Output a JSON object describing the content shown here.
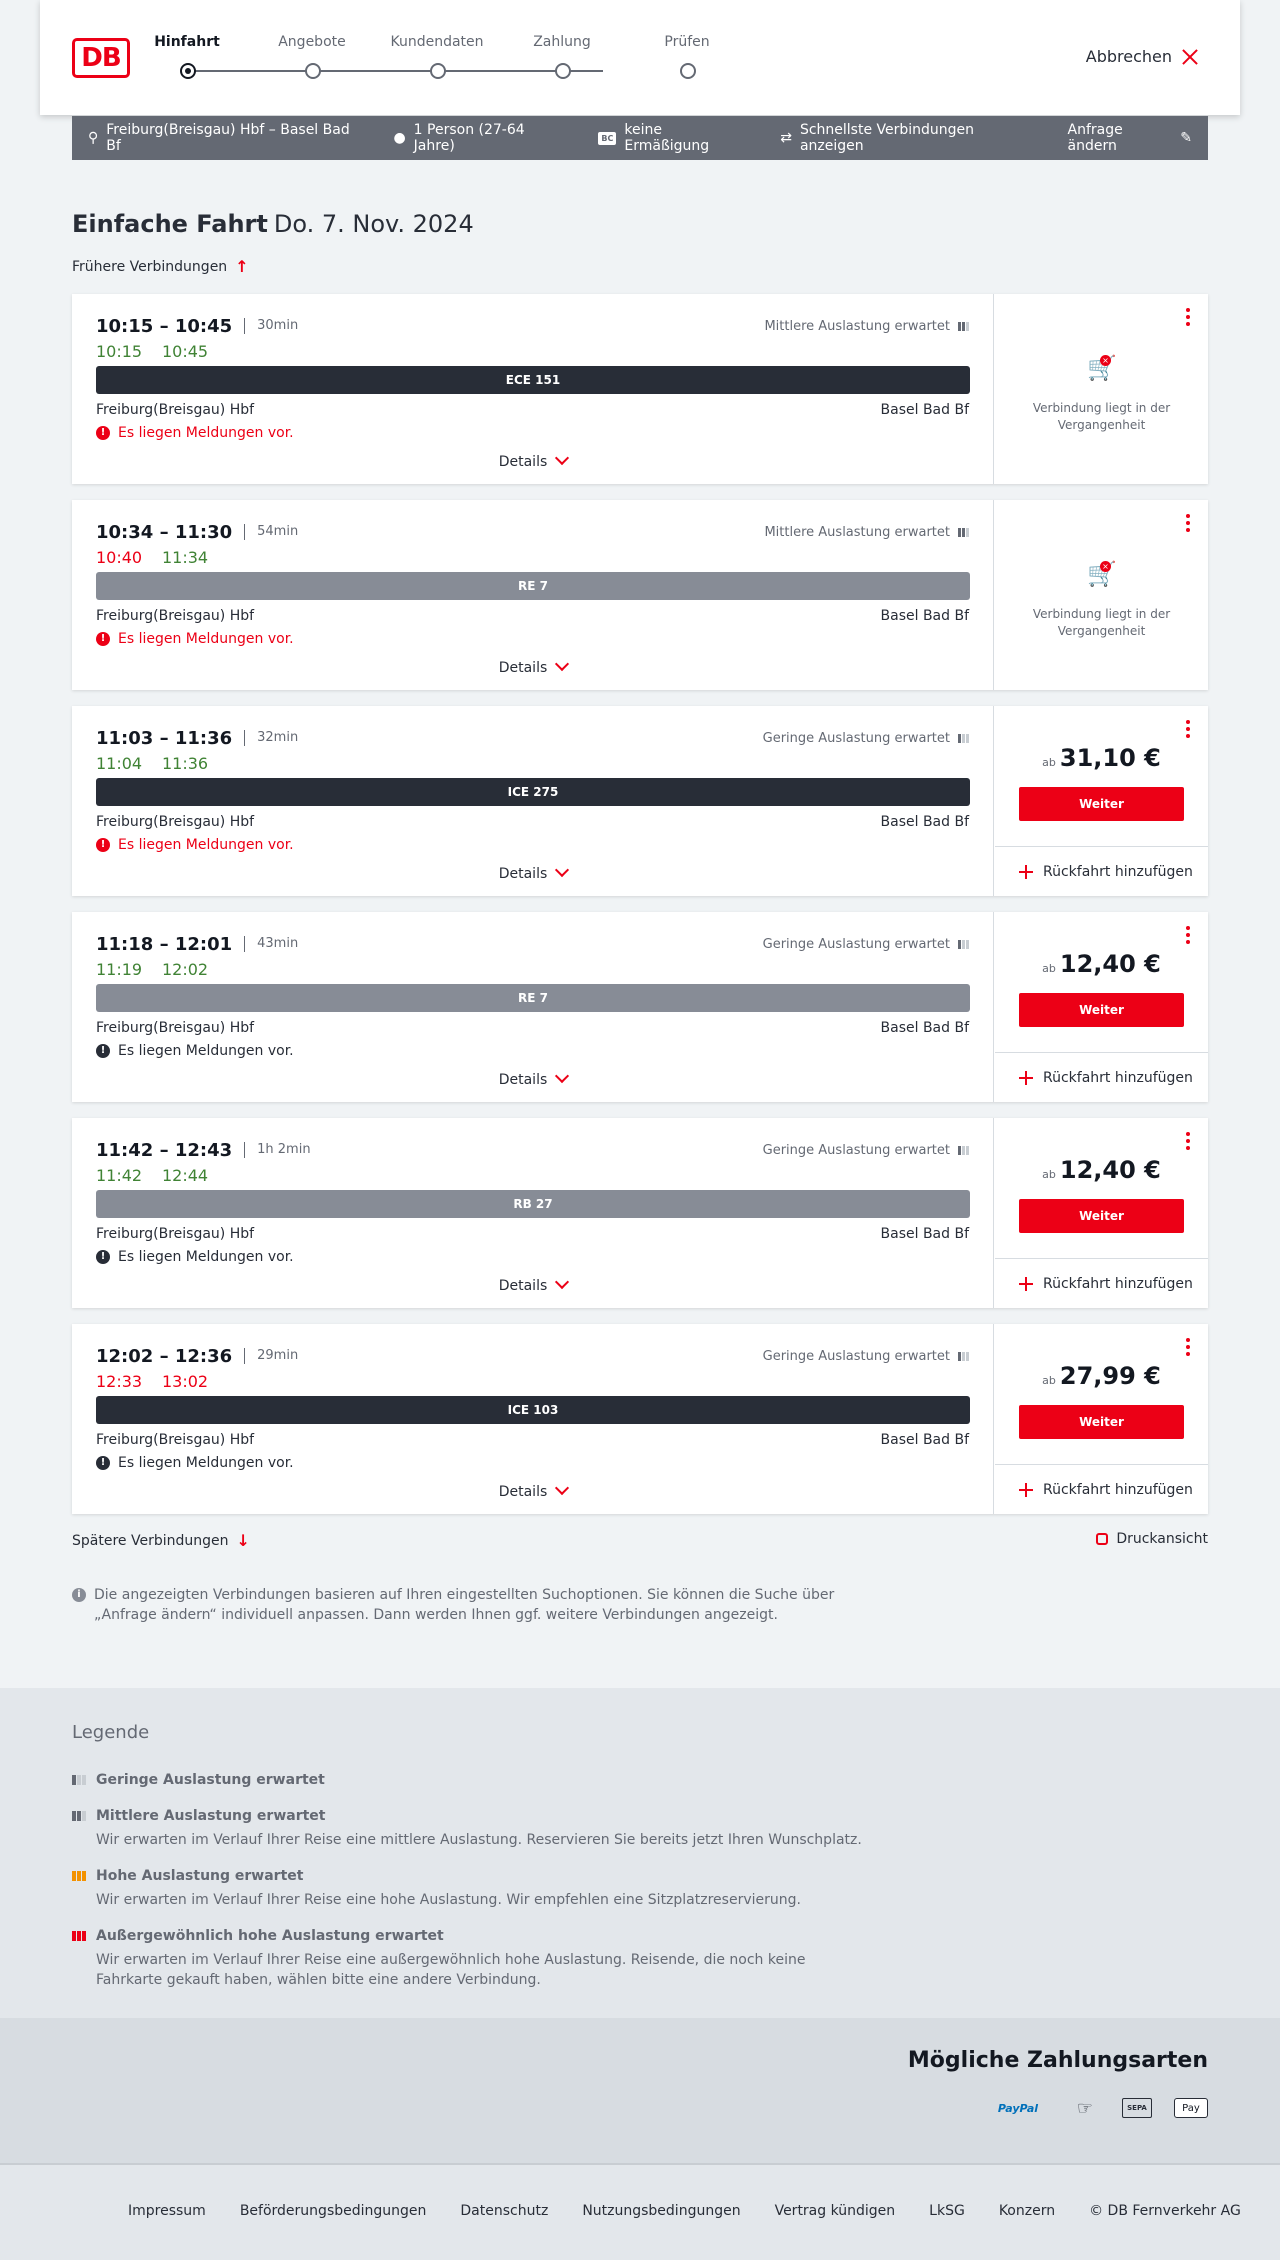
{
  "header": {
    "logo": "DB",
    "steps": [
      {
        "label": "Hinfahrt",
        "active": true
      },
      {
        "label": "Angebote",
        "active": false
      },
      {
        "label": "Kundendaten",
        "active": false
      },
      {
        "label": "Zahlung",
        "active": false
      },
      {
        "label": "Prüfen",
        "active": false
      }
    ],
    "cancel_label": "Abbrechen"
  },
  "search": {
    "route": "Freiburg(Breisgau) Hbf – Basel Bad Bf",
    "passengers": "1 Person (27-64 Jahre)",
    "bc_badge": "BC",
    "discount": "keine Ermäßigung",
    "fastest": "Schnellste Verbindungen anzeigen",
    "edit_label": "Anfrage ändern"
  },
  "title": {
    "main": "Einfache Fahrt",
    "date": "Do. 7. Nov. 2024"
  },
  "earlier_label": "Frühere Verbindungen",
  "later_label": "Spätere Verbindungen",
  "print_label": "Druckansicht",
  "details_label": "Details",
  "from_station": "Freiburg(Breisgau) Hbf",
  "to_station": "Basel Bad Bf",
  "notice_text": "Es liegen Meldungen vor.",
  "past_text": "Verbindung liegt in der Vergangenheit",
  "price_prefix": "ab",
  "weiter_label": "Weiter",
  "return_label": "Rückfahrt hinzufügen",
  "connections": [
    {
      "times": "10:15 – 10:45",
      "duration": "30min",
      "rt_dep": "10:15",
      "rt_dep_color": "green",
      "rt_arr": "10:45",
      "rt_arr_color": "green",
      "occupancy": "Mittlere Auslastung erwartet",
      "train": "ECE 151",
      "bar": "dark",
      "notice": "red",
      "past": true
    },
    {
      "times": "10:34 – 11:30",
      "duration": "54min",
      "rt_dep": "10:40",
      "rt_dep_color": "red",
      "rt_arr": "11:34",
      "rt_arr_color": "green",
      "occupancy": "Mittlere Auslastung erwartet",
      "train": "RE 7",
      "bar": "grey",
      "notice": "red",
      "past": true
    },
    {
      "times": "11:03 – 11:36",
      "duration": "32min",
      "rt_dep": "11:04",
      "rt_dep_color": "green",
      "rt_arr": "11:36",
      "rt_arr_color": "green",
      "occupancy": "Geringe Auslastung erwartet",
      "train": "ICE 275",
      "bar": "dark",
      "notice": "red",
      "past": false,
      "price": "31,10 €"
    },
    {
      "times": "11:18 – 12:01",
      "duration": "43min",
      "rt_dep": "11:19",
      "rt_dep_color": "green",
      "rt_arr": "12:02",
      "rt_arr_color": "green",
      "occupancy": "Geringe Auslastung erwartet",
      "train": "RE 7",
      "bar": "grey",
      "notice": "black",
      "past": false,
      "price": "12,40 €"
    },
    {
      "times": "11:42 – 12:43",
      "duration": "1h 2min",
      "rt_dep": "11:42",
      "rt_dep_color": "green",
      "rt_arr": "12:44",
      "rt_arr_color": "green",
      "occupancy": "Geringe Auslastung erwartet",
      "train": "RB 27",
      "bar": "grey",
      "notice": "black",
      "past": false,
      "price": "12,40 €"
    },
    {
      "times": "12:02 – 12:36",
      "duration": "29min",
      "rt_dep": "12:33",
      "rt_dep_color": "red",
      "rt_arr": "13:02",
      "rt_arr_color": "red",
      "occupancy": "Geringe Auslastung erwartet",
      "train": "ICE 103",
      "bar": "dark",
      "notice": "black",
      "past": false,
      "price": "27,99 €"
    }
  ],
  "info_text": "Die angezeigten Verbindungen basieren auf Ihren eingestellten Suchoptionen. Sie können die Suche über „Anfrage ändern“ individuell anpassen. Dann werden Ihnen ggf. weitere Verbindungen angezeigt.",
  "legend": {
    "title": "Legende",
    "items": [
      {
        "title": "Geringe Auslastung erwartet",
        "desc": ""
      },
      {
        "title": "Mittlere Auslastung erwartet",
        "desc": "Wir erwarten im Verlauf Ihrer Reise eine mittlere Auslastung. Reservieren Sie bereits jetzt Ihren Wunschplatz."
      },
      {
        "title": "Hohe Auslastung erwartet",
        "desc": "Wir erwarten im Verlauf Ihrer Reise eine hohe Auslastung. Wir empfehlen eine Sitzplatzreservierung."
      },
      {
        "title": "Außergewöhnlich hohe Auslastung erwartet",
        "desc": "Wir erwarten im Verlauf Ihrer Reise eine außergewöhnlich hohe Auslastung. Reisende, die noch keine Fahrkarte gekauft haben, wählen bitte eine andere Verbindung."
      }
    ]
  },
  "payment": {
    "title": "Mögliche Zahlungsarten",
    "methods": [
      "PayPal",
      "SEPA",
      "Pay"
    ]
  },
  "footer": {
    "links": [
      "Impressum",
      "Beförderungsbedingungen",
      "Datenschutz",
      "Nutzungsbedingungen",
      "Vertrag kündigen",
      "LkSG",
      "Konzern",
      "© DB Fernverkehr AG"
    ]
  }
}
